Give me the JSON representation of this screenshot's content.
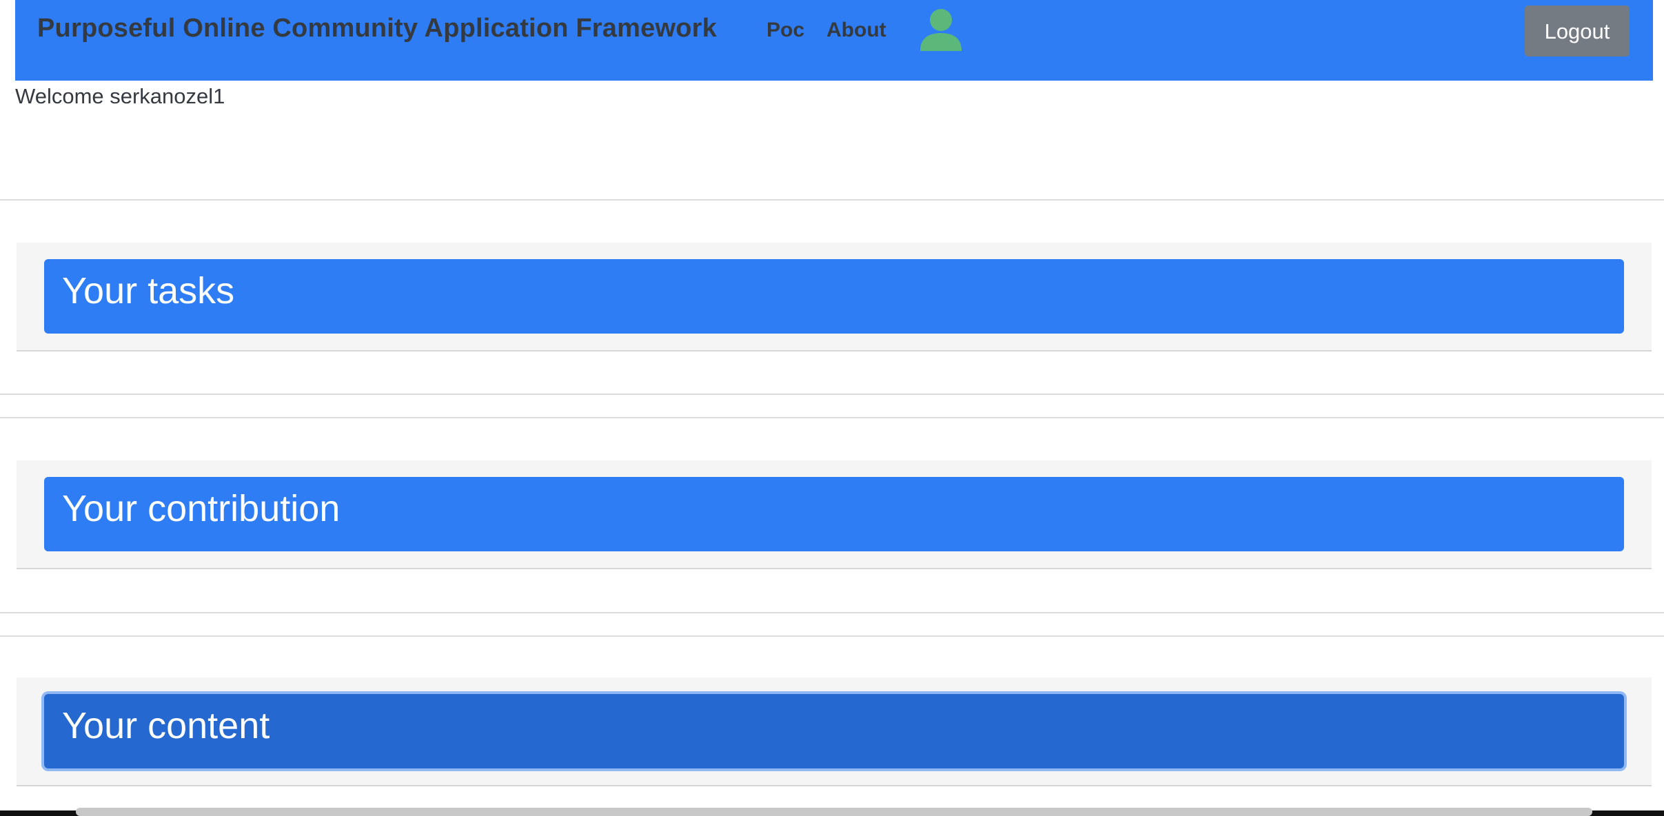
{
  "navbar": {
    "brand": "Purposeful Online Community Application Framework",
    "links": [
      {
        "label": "Poc"
      },
      {
        "label": "About"
      }
    ],
    "avatar_icon": "user-icon",
    "avatar_color": "#5cb87a",
    "logout_label": "Logout",
    "background_color": "#2e7df5"
  },
  "welcome": {
    "text": "Welcome serkanozel1"
  },
  "sections": [
    {
      "label": "Your tasks"
    },
    {
      "label": "Your contribution"
    },
    {
      "label": "Your content"
    }
  ],
  "colors": {
    "accent": "#2e7df5",
    "accent_active": "#2568d0",
    "logout_bg": "#757b82",
    "section_bg": "#f5f5f5"
  }
}
